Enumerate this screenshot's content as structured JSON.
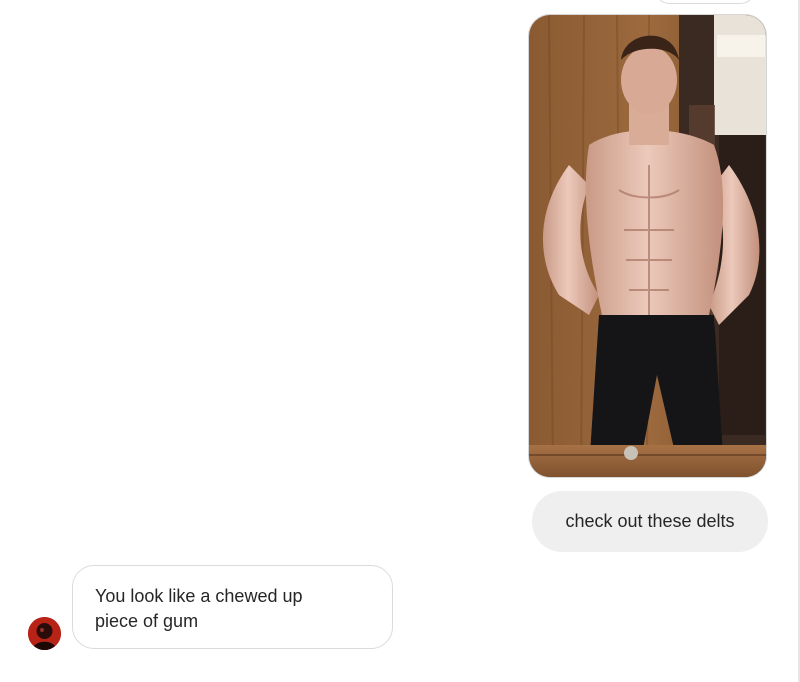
{
  "conversation": {
    "photo_message": {
      "image": "mirror-selfie-photo"
    },
    "sent_message": {
      "text": "check out these delts"
    },
    "received_message": {
      "text": "You look like a chewed up piece of gum"
    },
    "sender_avatar": {
      "image": "avatar-photo"
    }
  },
  "colors": {
    "sent_bubble_bg": "#efefef",
    "received_bubble_border": "#dbdbdb",
    "text": "#262626",
    "background": "#ffffff"
  }
}
